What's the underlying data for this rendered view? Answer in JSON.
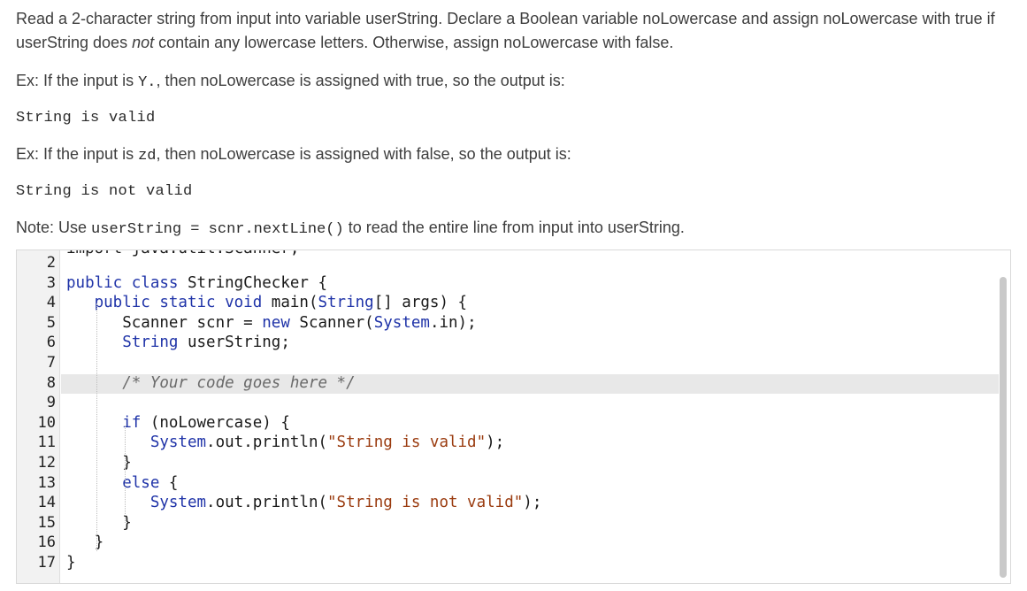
{
  "prompt": {
    "intro_part1": "Read a 2-character string from input into variable userString. Declare a Boolean variable noLowercase and assign noLowercase with true if userString does ",
    "intro_emph": "not",
    "intro_part2": " contain any lowercase letters. Otherwise, assign noLowercase with false.",
    "ex1_prefix": "Ex: If the input is ",
    "ex1_input": "Y.",
    "ex1_suffix": ", then noLowercase is assigned with true, so the output is:",
    "ex1_output": "String is valid",
    "ex2_prefix": "Ex: If the input is ",
    "ex2_input": "zd",
    "ex2_suffix": ", then noLowercase is assigned with false, so the output is:",
    "ex2_output": "String is not valid",
    "note_prefix": "Note: Use ",
    "note_code": "userString = scnr.nextLine()",
    "note_suffix": " to read the entire line from input into userString."
  },
  "editor": {
    "clipped_line": "import java.util.Scanner;",
    "lines": [
      {
        "n": "2",
        "code": []
      },
      {
        "n": "3",
        "code": [
          [
            "kw",
            "public class "
          ],
          [
            "",
            "StringChecker {"
          ]
        ]
      },
      {
        "n": "4",
        "code": [
          [
            "",
            "   "
          ],
          [
            "kw",
            "public static void "
          ],
          [
            "",
            "main("
          ],
          [
            "ty",
            "String"
          ],
          [
            "",
            "[] args) {"
          ]
        ]
      },
      {
        "n": "5",
        "code": [
          [
            "",
            "      Scanner scnr = "
          ],
          [
            "kw",
            "new "
          ],
          [
            "",
            "Scanner("
          ],
          [
            "ty",
            "System"
          ],
          [
            "",
            ".in);"
          ]
        ]
      },
      {
        "n": "6",
        "code": [
          [
            "",
            "      "
          ],
          [
            "ty",
            "String "
          ],
          [
            "",
            "userString;"
          ]
        ]
      },
      {
        "n": "7",
        "code": []
      },
      {
        "n": "8",
        "code": [
          [
            "",
            "      "
          ],
          [
            "cm",
            "/* Your code goes here */"
          ]
        ],
        "active": true
      },
      {
        "n": "9",
        "code": []
      },
      {
        "n": "10",
        "code": [
          [
            "",
            "      "
          ],
          [
            "kw",
            "if "
          ],
          [
            "",
            "(noLowercase) {"
          ]
        ]
      },
      {
        "n": "11",
        "code": [
          [
            "",
            "         "
          ],
          [
            "ty",
            "System"
          ],
          [
            "",
            ".out.println("
          ],
          [
            "str",
            "\"String is valid\""
          ],
          [
            "",
            ");"
          ]
        ]
      },
      {
        "n": "12",
        "code": [
          [
            "",
            "      }"
          ]
        ]
      },
      {
        "n": "13",
        "code": [
          [
            "",
            "      "
          ],
          [
            "kw",
            "else "
          ],
          [
            "",
            "{"
          ]
        ]
      },
      {
        "n": "14",
        "code": [
          [
            "",
            "         "
          ],
          [
            "ty",
            "System"
          ],
          [
            "",
            ".out.println("
          ],
          [
            "str",
            "\"String is not valid\""
          ],
          [
            "",
            ");"
          ]
        ]
      },
      {
        "n": "15",
        "code": [
          [
            "",
            "      }"
          ]
        ]
      },
      {
        "n": "16",
        "code": [
          [
            "",
            "   }"
          ]
        ]
      },
      {
        "n": "17",
        "code": [
          [
            "",
            "}"
          ]
        ]
      }
    ]
  }
}
